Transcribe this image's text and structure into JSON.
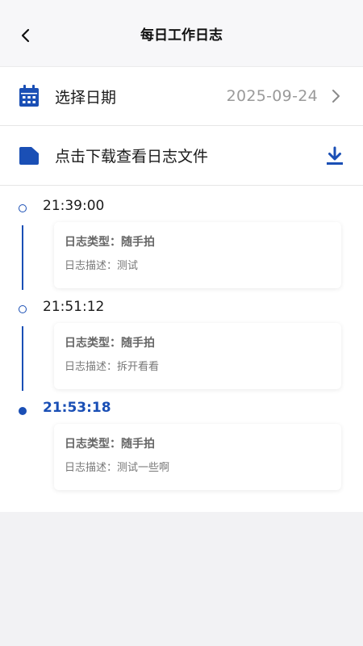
{
  "header": {
    "title": "每日工作日志"
  },
  "date_row": {
    "label": "选择日期",
    "value": "2025-09-24"
  },
  "download_row": {
    "label": "点击下载查看日志文件"
  },
  "entries": [
    {
      "time": "21:39:00",
      "type_text": "日志类型：随手拍",
      "desc_text": "日志描述：测试"
    },
    {
      "time": "21:51:12",
      "type_text": "日志类型：随手拍",
      "desc_text": "日志描述：拆开看看"
    },
    {
      "time": "21:53:18",
      "type_text": "日志类型：随手拍",
      "desc_text": "日志描述：测试一些啊"
    }
  ],
  "colors": {
    "accent": "#1a4fb5",
    "muted": "#9a9a9a",
    "background": "#f2f2f4"
  },
  "icons": {
    "back": "chevron-left-icon",
    "calendar": "calendar-icon",
    "folder": "folder-icon",
    "arrow": "chevron-right-icon",
    "download": "download-icon"
  }
}
